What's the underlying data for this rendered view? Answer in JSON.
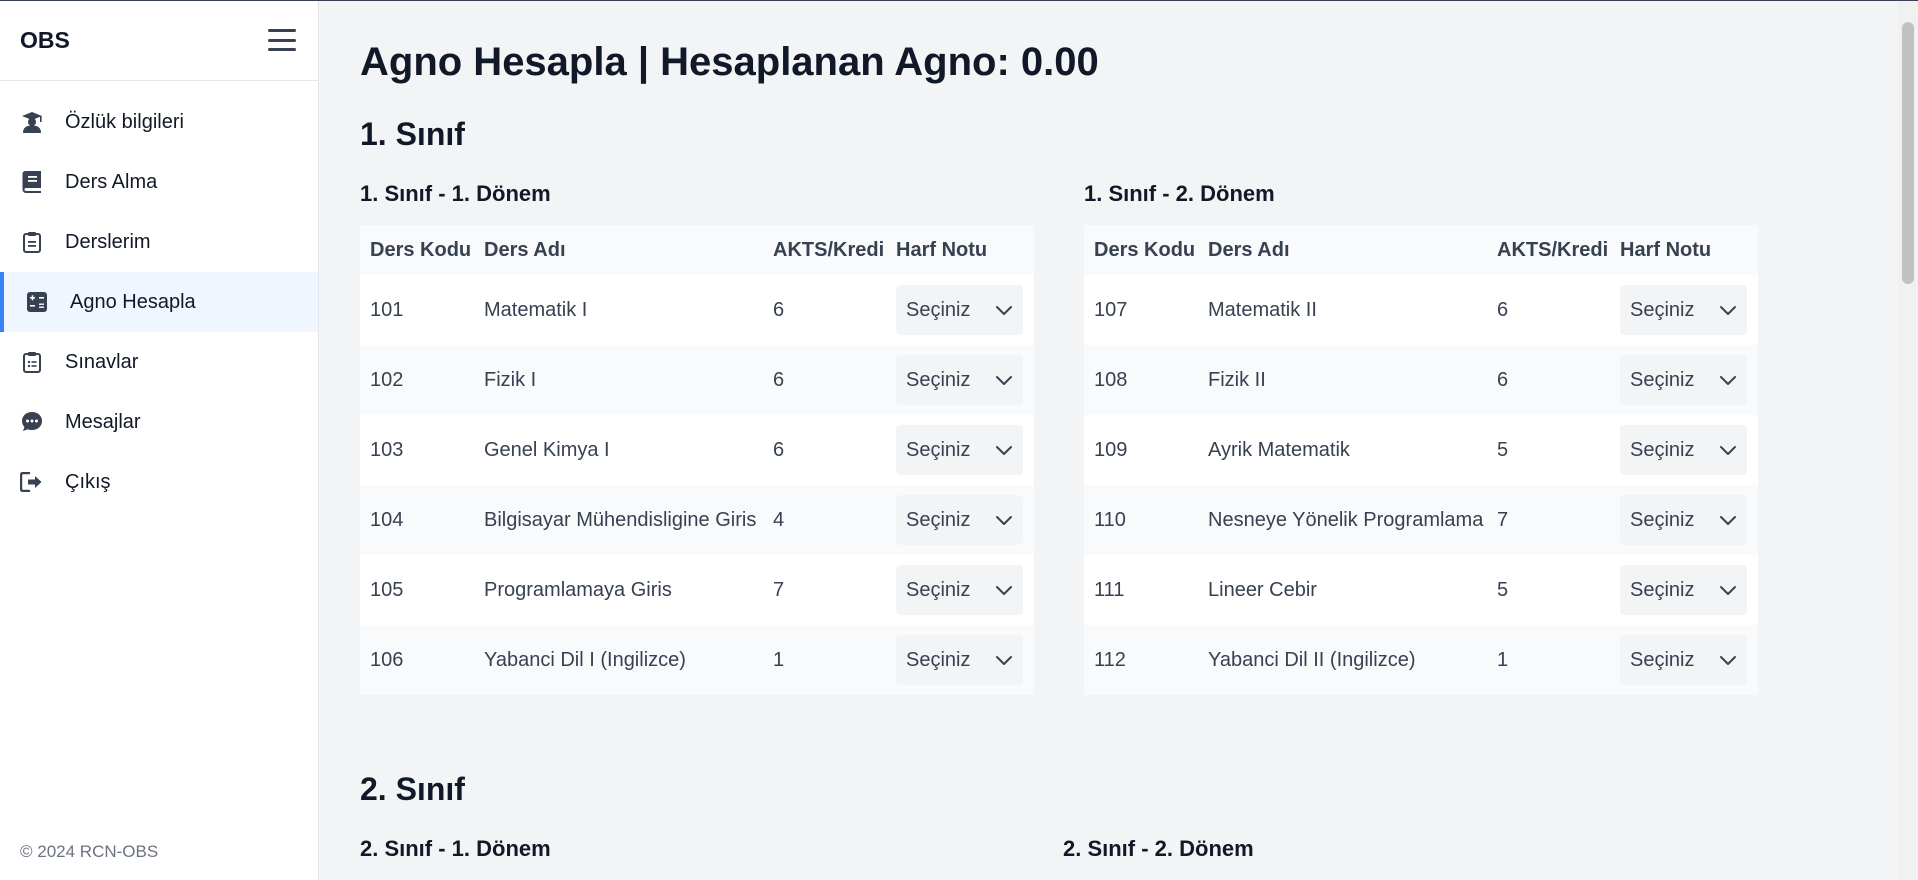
{
  "brand": "OBS",
  "sidebar": {
    "items": [
      {
        "label": "Özlük bilgileri",
        "icon": "graduate-icon"
      },
      {
        "label": "Ders Alma",
        "icon": "book-icon"
      },
      {
        "label": "Derslerim",
        "icon": "clipboard-icon"
      },
      {
        "label": "Agno Hesapla",
        "icon": "calculator-icon",
        "active": true
      },
      {
        "label": "Sınavlar",
        "icon": "clipboard-list-icon"
      },
      {
        "label": "Mesajlar",
        "icon": "chat-icon"
      },
      {
        "label": "Çıkış",
        "icon": "logout-icon"
      }
    ],
    "footer": "© 2024 RCN-OBS"
  },
  "main": {
    "title": "Agno Hesapla | Hesaplanan Agno: 0.00",
    "headers": [
      "Ders Kodu",
      "Ders Adı",
      "AKTS/Kredi",
      "Harf Notu"
    ],
    "select_placeholder": "Seçiniz",
    "years": [
      {
        "title": "1. Sınıf",
        "semesters": [
          {
            "title": "1. Sınıf - 1. Dönem",
            "courses": [
              {
                "code": "101",
                "name": "Matematik I",
                "credit": "6"
              },
              {
                "code": "102",
                "name": "Fizik I",
                "credit": "6"
              },
              {
                "code": "103",
                "name": "Genel Kimya I",
                "credit": "6"
              },
              {
                "code": "104",
                "name": "Bilgisayar Mühendisligine Giris",
                "credit": "4"
              },
              {
                "code": "105",
                "name": "Programlamaya Giris",
                "credit": "7"
              },
              {
                "code": "106",
                "name": "Yabanci Dil I (Ingilizce)",
                "credit": "1"
              }
            ]
          },
          {
            "title": "1. Sınıf - 2. Dönem",
            "courses": [
              {
                "code": "107",
                "name": "Matematik II",
                "credit": "6"
              },
              {
                "code": "108",
                "name": "Fizik II",
                "credit": "6"
              },
              {
                "code": "109",
                "name": "Ayrik Matematik",
                "credit": "5"
              },
              {
                "code": "110",
                "name": "Nesneye Yönelik Programlama",
                "credit": "7"
              },
              {
                "code": "111",
                "name": "Lineer Cebir",
                "credit": "5"
              },
              {
                "code": "112",
                "name": "Yabanci Dil II (Ingilizce)",
                "credit": "1"
              }
            ]
          }
        ]
      },
      {
        "title": "2. Sınıf",
        "semesters": [
          {
            "title": "2. Sınıf - 1. Dönem"
          },
          {
            "title": "2. Sınıf - 2. Dönem"
          }
        ]
      }
    ]
  }
}
